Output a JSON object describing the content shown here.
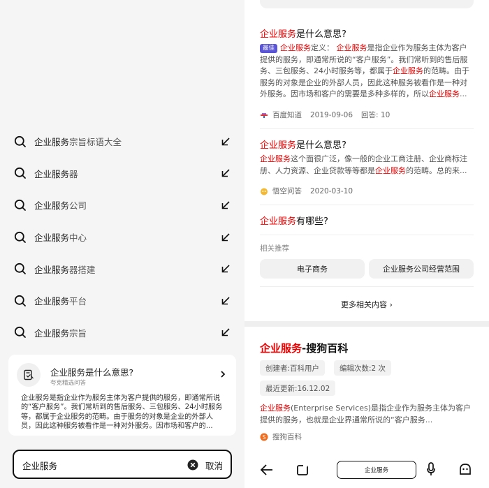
{
  "suggestions": [
    {
      "query": "企业服务",
      "rest": "宗旨标语大全"
    },
    {
      "query": "企业服务",
      "rest": "器"
    },
    {
      "query": "企业服务",
      "rest": "公司"
    },
    {
      "query": "企业服务",
      "rest": "中心"
    },
    {
      "query": "企业服务",
      "rest": "器搭建"
    },
    {
      "query": "企业服务",
      "rest": "平台"
    },
    {
      "query": "企业服务",
      "rest": "宗旨"
    }
  ],
  "qa_card": {
    "title": "企业服务是什么意思?",
    "subtitle": "夸克精选问答",
    "body": "企业服务是指企业作为服务主体为客户提供的服务，即通常所说的“客户服务”。我们常听到的售后服务、三包服务、24小时服务等，都属于企业服务的范畴。由于服务的对象是企业的外部人员，因此这种服务被看作是一种对外服务。因市场和客户的..."
  },
  "search": {
    "value": "企业服务",
    "cancel_label": "取消"
  },
  "results": {
    "item1": {
      "title_red": "企业服务",
      "title_rest": "是什么意思?",
      "badge": "最佳",
      "text_parts": [
        "企业服务",
        "定义：  ",
        "企业服务",
        "是指企业作为服务主体为客户提供的服务，即通常所说的“客户服务”。我们常听到的售后服务、三包服务、24小时服务等，都属于",
        "企业服务",
        "的范畴。由于服务的对象是企业的外部人员，因此这种服务被看作是一种对外服务。因市场和客户的需要是多种多样的，所以",
        "企业服务",
        "..."
      ],
      "source": "百度知道",
      "date": "2019-09-06",
      "answers": "回答: 10"
    },
    "item2": {
      "title_red": "企业服务",
      "title_rest": "是什么意思?",
      "text_parts": [
        "企业服务",
        "这个面很广泛，像一般的企业工商注册、企业商标注册、人力资源、企业贷款等等都是",
        "企业服务",
        "的范畴。总的来..."
      ],
      "source": "悟空问答",
      "date": "2020-03-10"
    },
    "item3": {
      "title_red": "企业服务",
      "title_rest": "有哪些?"
    },
    "related_label": "相关推荐",
    "chips": [
      "电子商务",
      "企业服务公司经营范围"
    ],
    "more_label": "更多相关内容"
  },
  "baike": {
    "title_red": "企业服务",
    "title_rest": "-搜狗百科",
    "creator": "创建者:百科用户",
    "edits": "编辑次数:2 次",
    "updated": "最近更新:16.12.02",
    "text_red": "企业服务",
    "text_rest": "(Enterprise Services)是指企业作为服务主体为客户提供的服务，也就是企业界通常所说的“客户服务...",
    "source": "搜狗百科"
  },
  "bottom_nav": {
    "search_label": "企业服务"
  },
  "colors": {
    "accent_red": "#e00000",
    "badge_purple": "#5a54d6"
  }
}
